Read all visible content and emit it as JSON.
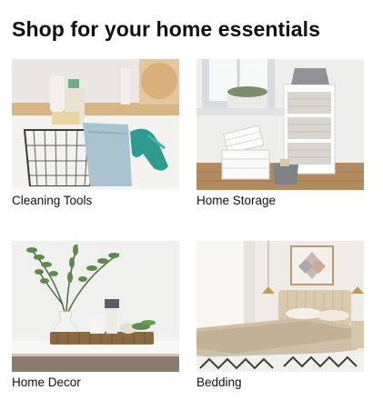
{
  "card": {
    "title": "Shop for your home essentials"
  },
  "tiles": [
    {
      "label": "Cleaning Tools",
      "image": "cleaning-tools-photo"
    },
    {
      "label": "Home Storage",
      "image": "home-storage-photo"
    },
    {
      "label": "Home Decor",
      "image": "home-decor-photo"
    },
    {
      "label": "Bedding",
      "image": "bedding-photo"
    }
  ]
}
